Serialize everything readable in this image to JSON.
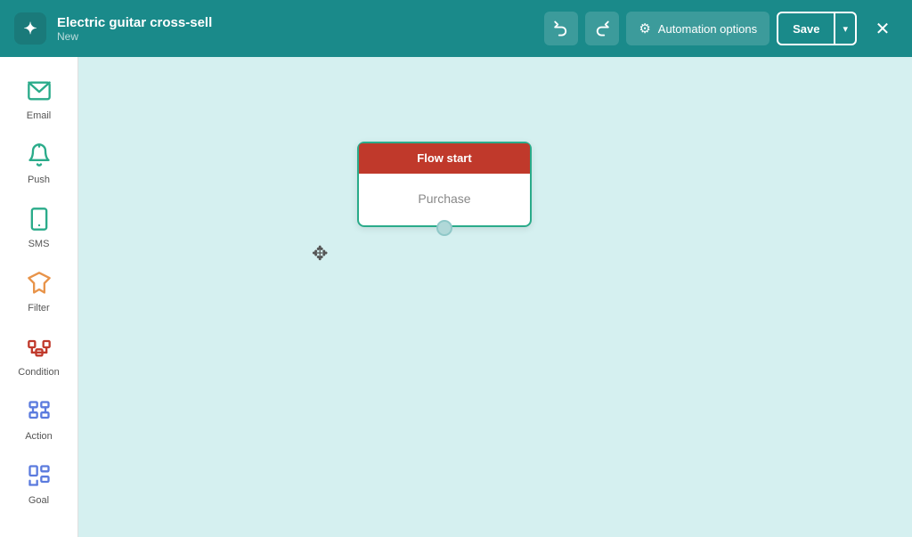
{
  "header": {
    "logo_symbol": "✦",
    "title": "Electric guitar cross-sell",
    "subtitle": "New",
    "undo_label": "↩",
    "redo_label": "↪",
    "automation_options_label": "Automation options",
    "save_label": "Save",
    "save_arrow": "▾",
    "close_label": "✕"
  },
  "sidebar": {
    "items": [
      {
        "id": "email",
        "label": "Email",
        "icon": "email-icon"
      },
      {
        "id": "push",
        "label": "Push",
        "icon": "push-icon"
      },
      {
        "id": "sms",
        "label": "SMS",
        "icon": "sms-icon"
      },
      {
        "id": "filter",
        "label": "Filter",
        "icon": "filter-icon"
      },
      {
        "id": "condition",
        "label": "Condition",
        "icon": "condition-icon"
      },
      {
        "id": "action",
        "label": "Action",
        "icon": "action-icon"
      },
      {
        "id": "goal",
        "label": "Goal",
        "icon": "goal-icon"
      }
    ]
  },
  "canvas": {
    "flow_node": {
      "header": "Flow start",
      "body": "Purchase"
    }
  }
}
